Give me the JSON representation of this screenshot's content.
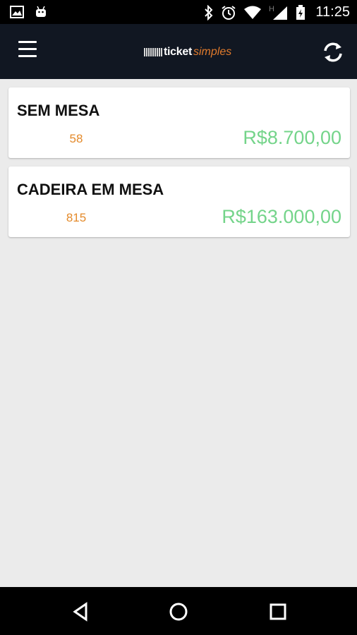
{
  "status_bar": {
    "time": "11:25",
    "icons": [
      "gallery-icon",
      "android-icon",
      "bluetooth-icon",
      "alarm-icon",
      "wifi-icon",
      "signal-icon",
      "battery-icon"
    ]
  },
  "app_bar": {
    "logo_word1": "ticket",
    "logo_word2": "simples",
    "accent_color": "#e07a2c",
    "background_color": "#111722"
  },
  "items": [
    {
      "title": "SEM MESA",
      "count": "58",
      "price": "R$8.700,00"
    },
    {
      "title": "CADEIRA EM MESA",
      "count": "815",
      "price": "R$163.000,00"
    }
  ],
  "colors": {
    "count": "#e48a2a",
    "price": "#74d48a"
  }
}
